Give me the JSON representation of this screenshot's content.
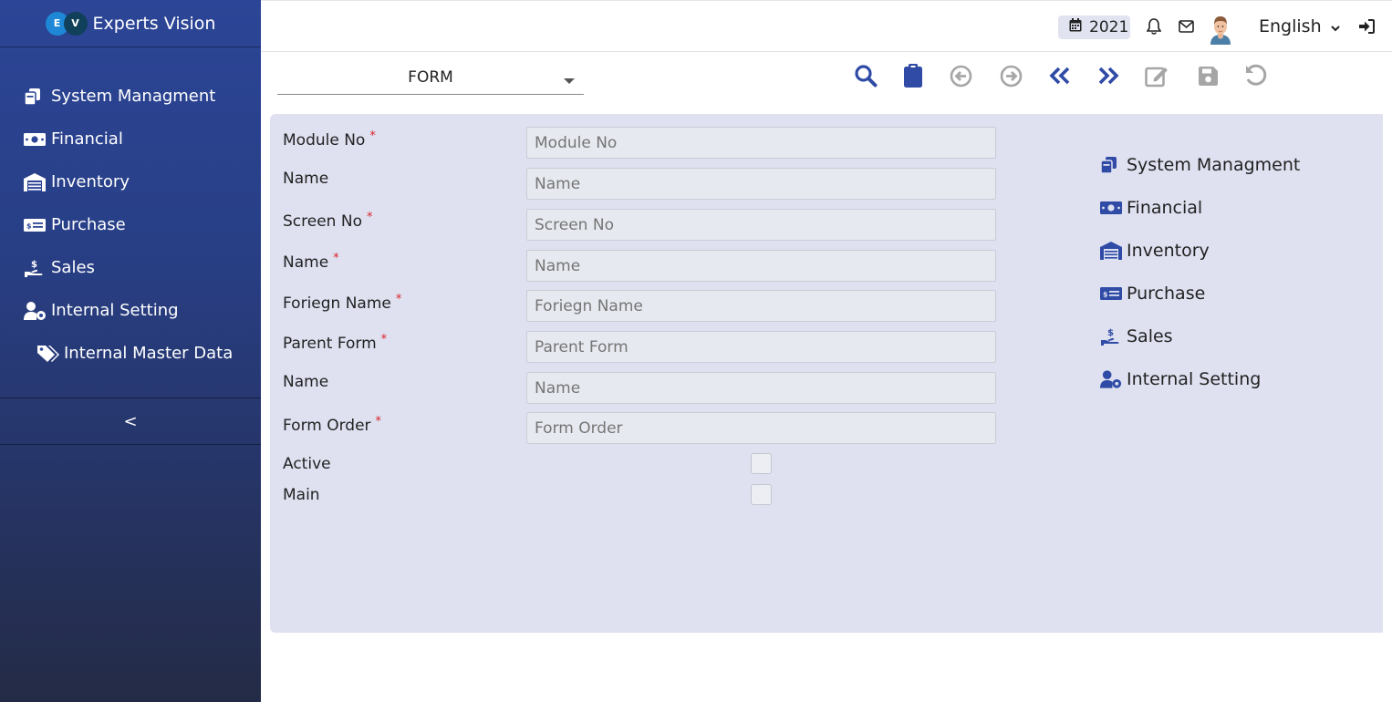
{
  "brand": {
    "logo_letters": [
      "E",
      "V"
    ],
    "name": "Experts Vision"
  },
  "sidebar": {
    "items": [
      {
        "label": "System Managment",
        "icon": "copy-icon"
      },
      {
        "label": "Financial",
        "icon": "money-bill-icon"
      },
      {
        "label": "Inventory",
        "icon": "warehouse-icon"
      },
      {
        "label": "Purchase",
        "icon": "money-check-icon"
      },
      {
        "label": "Sales",
        "icon": "hand-holding-dollar-icon"
      },
      {
        "label": "Internal Setting",
        "icon": "user-cog-icon"
      },
      {
        "label": "Internal Master Data",
        "icon": "tags-icon"
      }
    ],
    "collapse_label": "<"
  },
  "header": {
    "year": "2021",
    "language": "English"
  },
  "toolbar": {
    "form_select": "FORM",
    "buttons": [
      "search-icon",
      "clipboard-icon",
      "arrow-left-icon",
      "arrow-right-icon",
      "double-left-icon",
      "double-right-icon",
      "edit-icon",
      "save-icon",
      "undo-icon"
    ]
  },
  "form": {
    "fields": [
      {
        "label": "Module No",
        "required": "*",
        "placeholder": "Module No"
      },
      {
        "label": "Name",
        "required": "",
        "placeholder": "Name"
      },
      {
        "label": "Screen No",
        "required": "*",
        "placeholder": "Screen No"
      },
      {
        "label": "Name",
        "required": "*",
        "placeholder": "Name"
      },
      {
        "label": "Foriegn Name",
        "required": "*",
        "placeholder": "Foriegn Name"
      },
      {
        "label": "Parent Form",
        "required": "*",
        "placeholder": "Parent Form"
      },
      {
        "label": "Name",
        "required": "",
        "placeholder": "Name"
      },
      {
        "label": "Form Order",
        "required": "*",
        "placeholder": "Form Order"
      }
    ],
    "checkboxes": [
      {
        "label": "Active"
      },
      {
        "label": "Main"
      }
    ]
  },
  "quick_links": [
    {
      "label": "System Managment"
    },
    {
      "label": "Financial"
    },
    {
      "label": "Inventory"
    },
    {
      "label": "Purchase"
    },
    {
      "label": "Sales"
    },
    {
      "label": "Internal Setting"
    }
  ],
  "colors": {
    "accent": "#2f4ba6",
    "disabled": "#9e9e9e",
    "required": "#d9232b",
    "panel": "#dfe1f1"
  }
}
